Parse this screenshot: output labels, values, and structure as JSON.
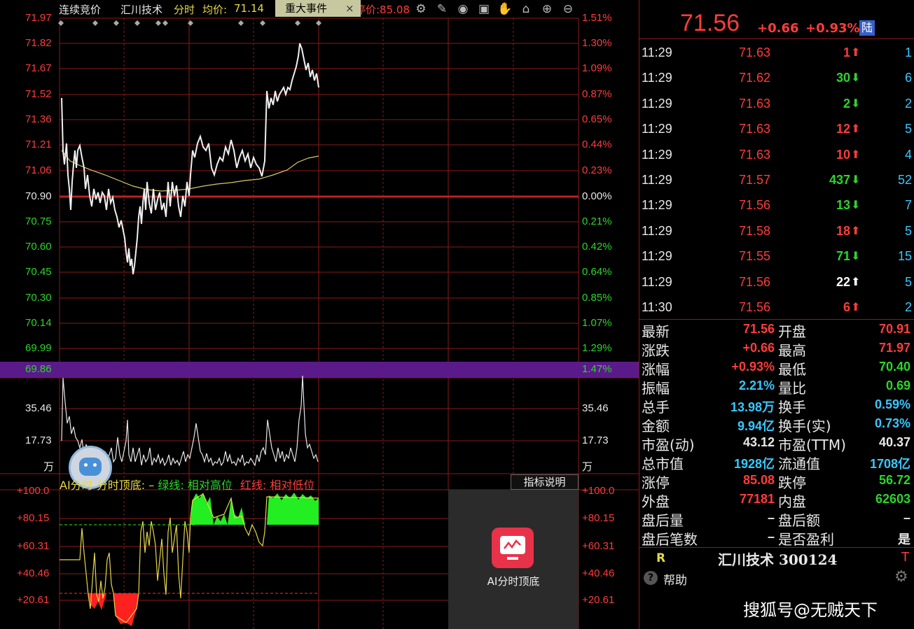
{
  "header": {
    "auction_label": "连续竞价",
    "stock_name": "汇川技术",
    "mode": "分时",
    "avg_label": "均价:",
    "avg_value": "71.14",
    "event_button": "重大事件",
    "close_glyph": "×",
    "limit_text": "涨停价:85.08"
  },
  "price_axis_left": [
    "71.97",
    "71.82",
    "71.67",
    "71.52",
    "71.36",
    "71.21",
    "71.06",
    "70.90",
    "70.75",
    "70.60",
    "70.45",
    "70.30",
    "70.14",
    "69.99",
    "69.86"
  ],
  "pct_axis_right": [
    "1.51%",
    "1.30%",
    "1.09%",
    "0.87%",
    "0.65%",
    "0.44%",
    "0.23%",
    "0.00%",
    "0.21%",
    "0.42%",
    "0.64%",
    "0.85%",
    "1.07%",
    "1.29%",
    "1.47%"
  ],
  "volume_axis": [
    "35.46",
    "17.73",
    "万"
  ],
  "indicator": {
    "title": "AI分时 分时顶底:",
    "dash": "–",
    "green_label": "绿线: 相对高位",
    "red_label": "红线: 相对低位",
    "explain_button": "指标说明",
    "axis": [
      "+100.0",
      "+80.15",
      "+60.31",
      "+40.46",
      "+20.61"
    ]
  },
  "ai_card": {
    "label": "AI分时顶底"
  },
  "quote": {
    "price": "71.56",
    "change": "+0.66",
    "change_pct": "+0.93%",
    "badge": "陆"
  },
  "ticks": [
    {
      "time": "11:29",
      "price": "71.63",
      "vol": "1",
      "dir": "up",
      "count": "1"
    },
    {
      "time": "11:29",
      "price": "71.62",
      "vol": "30",
      "dir": "down",
      "count": "6"
    },
    {
      "time": "11:29",
      "price": "71.63",
      "vol": "2",
      "dir": "down",
      "count": "2"
    },
    {
      "time": "11:29",
      "price": "71.63",
      "vol": "12",
      "dir": "up",
      "count": "5"
    },
    {
      "time": "11:29",
      "price": "71.63",
      "vol": "10",
      "dir": "up",
      "count": "4"
    },
    {
      "time": "11:29",
      "price": "71.57",
      "vol": "437",
      "dir": "down",
      "count": "52"
    },
    {
      "time": "11:29",
      "price": "71.56",
      "vol": "13",
      "dir": "down",
      "count": "7"
    },
    {
      "time": "11:29",
      "price": "71.58",
      "vol": "18",
      "dir": "up",
      "count": "5"
    },
    {
      "time": "11:29",
      "price": "71.55",
      "vol": "71",
      "dir": "down",
      "count": "15"
    },
    {
      "time": "11:29",
      "price": "71.56",
      "vol": "22",
      "dir": "up-white",
      "count": "5"
    },
    {
      "time": "11:30",
      "price": "71.56",
      "vol": "6",
      "dir": "up",
      "count": "2"
    }
  ],
  "stats": [
    {
      "l1": "最新",
      "v1": "71.56",
      "c1": "red",
      "l2": "开盘",
      "v2": "70.91",
      "c2": "red"
    },
    {
      "l1": "涨跌",
      "v1": "+0.66",
      "c1": "red",
      "l2": "最高",
      "v2": "71.97",
      "c2": "red"
    },
    {
      "l1": "涨幅",
      "v1": "+0.93%",
      "c1": "red",
      "l2": "最低",
      "v2": "70.40",
      "c2": "green"
    },
    {
      "l1": "振幅",
      "v1": "2.21%",
      "c1": "cyan",
      "l2": "量比",
      "v2": "0.69",
      "c2": "green"
    },
    {
      "l1": "总手",
      "v1": "13.98万",
      "c1": "cyan",
      "l2": "换手",
      "v2": "0.59%",
      "c2": "cyan"
    },
    {
      "l1": "金额",
      "v1": "9.94亿",
      "c1": "cyan",
      "l2": "换手(实)",
      "v2": "0.73%",
      "c2": "cyan"
    },
    {
      "l1": "市盈(动)",
      "v1": "43.12",
      "c1": "white",
      "l2": "市盈(TTM)",
      "v2": "40.37",
      "c2": "white"
    },
    {
      "l1": "总市值",
      "v1": "1928亿",
      "c1": "cyan",
      "l2": "流通值",
      "v2": "1708亿",
      "c2": "cyan"
    },
    {
      "l1": "涨停",
      "v1": "85.08",
      "c1": "red",
      "l2": "跌停",
      "v2": "56.72",
      "c2": "green"
    },
    {
      "l1": "外盘",
      "v1": "77181",
      "c1": "red",
      "l2": "内盘",
      "v2": "62603",
      "c2": "green"
    },
    {
      "l1": "盘后量",
      "v1": "–",
      "c1": "white",
      "l2": "盘后额",
      "v2": "–",
      "c2": "white"
    },
    {
      "l1": "盘后笔数",
      "v1": "–",
      "c1": "white",
      "l2": "是否盈利",
      "v2": "是",
      "c2": "white"
    }
  ],
  "footer": {
    "r_label": "R",
    "stock_title": "汇川技术 300124",
    "t_label": "T",
    "help_label": "帮助",
    "watermark": "搜狐号@无贼天下"
  },
  "colors": {
    "up": "#ff3c3c",
    "down": "#2bd62b",
    "grid": "#8b1a1a",
    "ai_red": "#e8324a"
  }
}
